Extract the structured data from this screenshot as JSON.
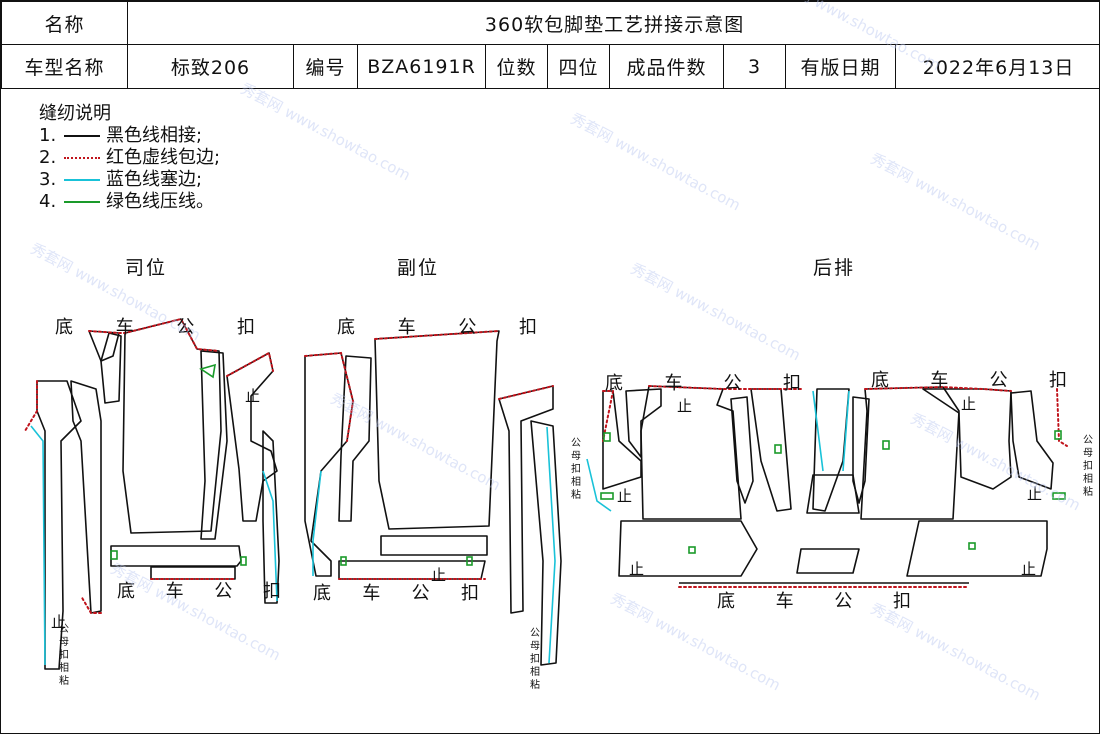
{
  "header": {
    "name_label": "名称",
    "name_value": "360软包脚垫工艺拼接示意图",
    "model_label": "车型名称",
    "model_value": "标致206",
    "code_label": "编号",
    "code_value": "BZA6191R",
    "seat_label": "位数",
    "seat_value": "四位",
    "count_label": "成品件数",
    "count_value": "3",
    "date_label": "有版日期",
    "date_value": "2022年6月13日"
  },
  "legend": {
    "title": "缝纫说明",
    "items": [
      {
        "num": "1.",
        "text": "黑色线相接;",
        "color": "#111111"
      },
      {
        "num": "2.",
        "text": "红色虚线包边;",
        "color": "#c0141c"
      },
      {
        "num": "3.",
        "text": "蓝色线塞边;",
        "color": "#19c2d8"
      },
      {
        "num": "4.",
        "text": "绿色线压线。",
        "color": "#1a9a2a"
      }
    ]
  },
  "sections": {
    "driver": "司位",
    "passenger": "副位",
    "rear": "后排"
  },
  "labels": {
    "bottom_buckle": [
      "底",
      "车",
      "公",
      "扣"
    ],
    "stop": "止",
    "velcro": [
      "公",
      "母",
      "扣",
      "相",
      "粘"
    ]
  },
  "watermark": {
    "cn": "秀套网",
    "url": "www.showtao.com"
  },
  "colors": {
    "black_line": "#111111",
    "red_dashed": "#c0141c",
    "blue_line": "#19c2d8",
    "green_line": "#1a9a2a"
  }
}
